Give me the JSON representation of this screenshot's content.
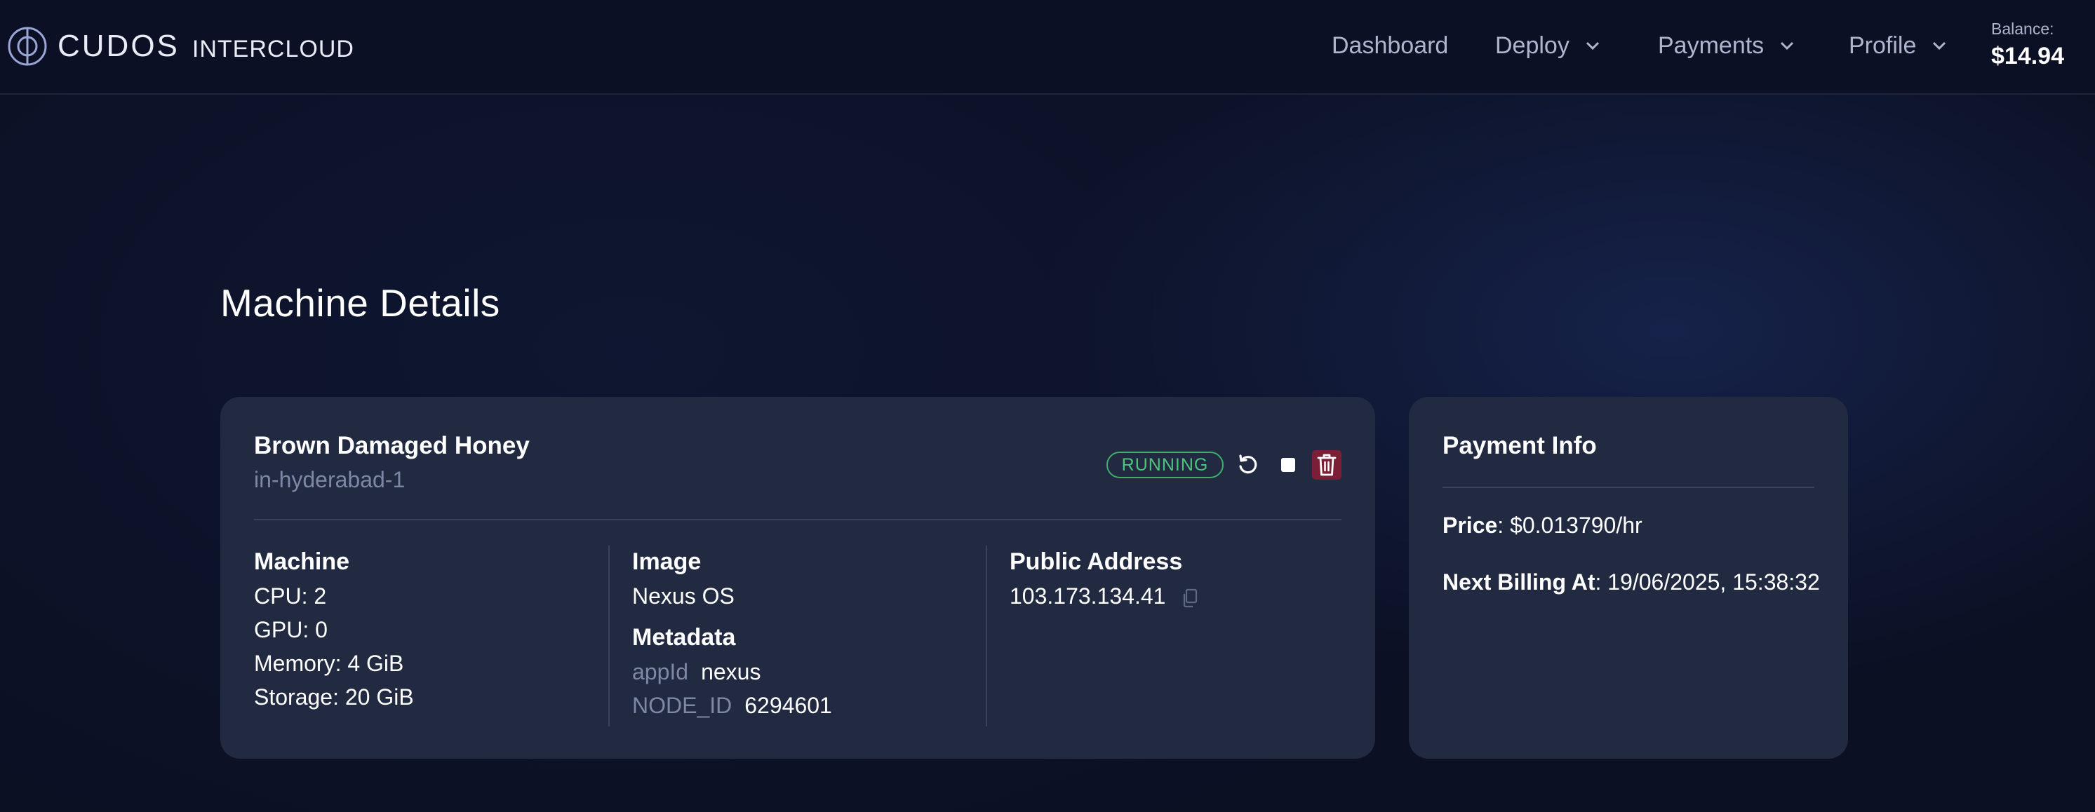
{
  "header": {
    "logo_main": "CUDOS",
    "logo_sub": "INTERCLOUD",
    "nav": [
      {
        "label": "Dashboard",
        "dropdown": false
      },
      {
        "label": "Deploy",
        "dropdown": true
      },
      {
        "label": "Payments",
        "dropdown": true
      },
      {
        "label": "Profile",
        "dropdown": true
      }
    ],
    "balance_label": "Balance:",
    "balance_value": "$14.94"
  },
  "page": {
    "title": "Machine Details"
  },
  "machine": {
    "name": "Brown Damaged Honey",
    "region": "in-hyderabad-1",
    "status": "RUNNING",
    "machine_title": "Machine",
    "specs": [
      "CPU: 2",
      "GPU: 0",
      "Memory: 4 GiB",
      "Storage: 20 GiB"
    ],
    "image_title": "Image",
    "image_value": "Nexus OS",
    "metadata_title": "Metadata",
    "metadata": [
      {
        "key": "appId",
        "value": "nexus"
      },
      {
        "key": "NODE_ID",
        "value": "6294601"
      }
    ],
    "address_title": "Public Address",
    "address_value": "103.173.134.41"
  },
  "payment": {
    "title": "Payment Info",
    "price_label": "Price",
    "price_value": ": $0.013790/hr",
    "billing_label": "Next Billing At",
    "billing_value": ": 19/06/2025, 15:38:32"
  },
  "colors": {
    "background": "#0b1023",
    "card": "#222a42",
    "status_green": "#4cc47c",
    "delete_red": "#7a1f35",
    "muted_text": "#7e87a3"
  },
  "icons": [
    "cudos-logo-icon",
    "chevron-down-icon",
    "restart-icon",
    "stop-icon",
    "trash-icon",
    "copy-icon"
  ]
}
